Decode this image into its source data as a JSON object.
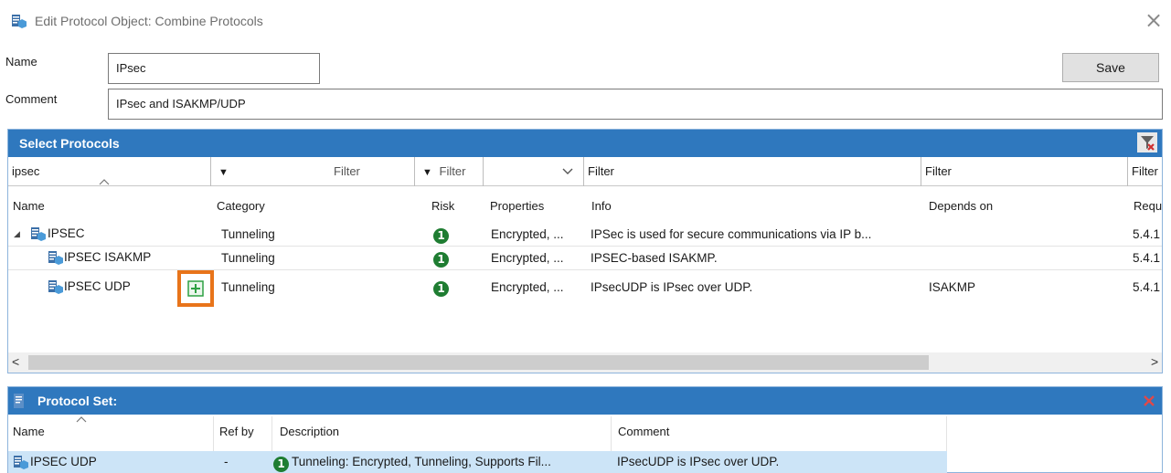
{
  "window": {
    "title": "Edit Protocol Object: Combine Protocols",
    "close_glyph": "×"
  },
  "form": {
    "name_label": "Name",
    "name_value": "IPsec",
    "comment_label": "Comment",
    "comment_value": "IPsec and ISAKMP/UDP",
    "save_label": "Save"
  },
  "select_protocols": {
    "title": "Select Protocols",
    "filters": {
      "name": "ipsec",
      "category_arrow": "▼",
      "category": "Filter",
      "risk_arrow": "▼",
      "risk": "Filter",
      "properties_dropdown": "",
      "info": "Filter",
      "depends": "Filter",
      "req": "Filter"
    },
    "columns": [
      "Name",
      "Category",
      "Risk",
      "Properties",
      "Info",
      "Depends on",
      "Requ"
    ],
    "rows": [
      {
        "name": "IPSEC",
        "category": "Tunneling",
        "risk": "1",
        "properties": "Encrypted, ...",
        "info": "IPSec is used for secure communications via IP b...",
        "depends": "",
        "req": "5.4.1"
      },
      {
        "name": "IPSEC ISAKMP",
        "category": "Tunneling",
        "risk": "1",
        "properties": "Encrypted, ...",
        "info": "IPSEC-based ISAKMP.",
        "depends": "",
        "req": "5.4.1"
      },
      {
        "name": "IPSEC UDP",
        "category": "Tunneling",
        "risk": "1",
        "properties": "Encrypted, ...",
        "info": "IPsecUDP is IPsec over UDP.",
        "depends": "ISAKMP",
        "req": "5.4.1"
      }
    ],
    "expand_glyph": "◢",
    "scroll_left": "<",
    "scroll_right": ">"
  },
  "protocol_set": {
    "title": "Protocol Set:",
    "columns": [
      "Name",
      "Ref by",
      "Description",
      "Comment"
    ],
    "rows": [
      {
        "name": "IPSEC UDP",
        "ref_by": "-",
        "risk": "1",
        "description": "Tunneling: Encrypted, Tunneling, Supports Fil...",
        "comment": "IPsecUDP is IPsec over UDP."
      }
    ]
  },
  "colors": {
    "header_blue": "#2f78be",
    "risk_green": "#1f7d32",
    "highlight_orange": "#e8741a",
    "add_green": "#2ea043",
    "selection": "#cce4f7"
  }
}
